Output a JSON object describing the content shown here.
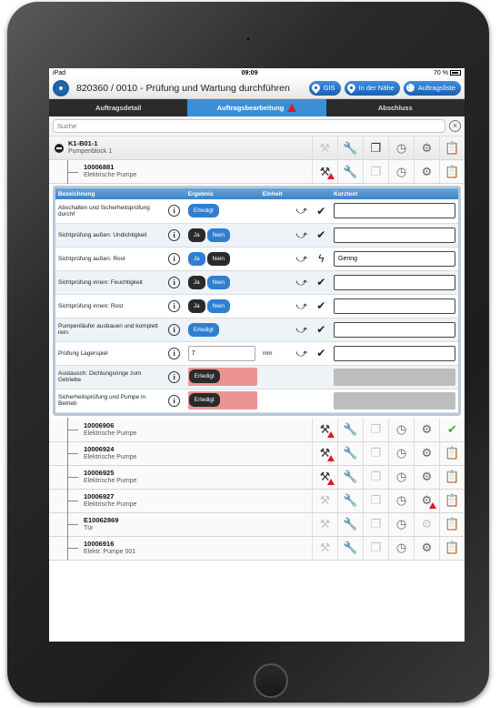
{
  "status": {
    "device": "iPad",
    "time": "09:09",
    "battery": "70 %"
  },
  "header": {
    "title": "820360 / 0010 - Prüfung und Wartung durchführen",
    "gis": "GIS",
    "nearby": "In der Nähe",
    "orders": "Auftragsliste"
  },
  "tabs": [
    "Auftragsdetail",
    "Auftragsbearbeitung",
    "Abschluss"
  ],
  "search": {
    "placeholder": "Suche"
  },
  "top_rows": [
    {
      "id": "K1-B01-1",
      "desc": "Pumpenblock 1"
    },
    {
      "id": "10006881",
      "desc": "Elektrische Pumpe"
    }
  ],
  "table": {
    "headers": [
      "Bezeichnung",
      "Ergebnis",
      "Einheit",
      "Kurztext"
    ],
    "rows": [
      {
        "name": "Abschalten und Sicherheitsprüfung durchf",
        "result": "Erledigt",
        "unit": "",
        "kurztext": ""
      },
      {
        "name": "Sichtprüfung außen: Undichtigkeit",
        "ja": "Ja",
        "nein": "Nein",
        "unit": "",
        "kurztext": ""
      },
      {
        "name": "Sichtprüfung außen: Rost",
        "ja": "Ja",
        "nein": "Nein",
        "unit": "",
        "kurztext": "Gering"
      },
      {
        "name": "Sichtprüfung innen: Feuchtigkeit",
        "ja": "Ja",
        "nein": "Nein",
        "unit": "",
        "kurztext": ""
      },
      {
        "name": "Sichtprüfung innen: Rost",
        "ja": "Ja",
        "nein": "Nein",
        "unit": "",
        "kurztext": ""
      },
      {
        "name": "Pumpenläufer ausbauen und komplett rein.",
        "result": "Erledigt",
        "unit": "",
        "kurztext": ""
      },
      {
        "name": "Prüfung Lagerspiel",
        "value": "7",
        "unit": "mm",
        "kurztext": ""
      },
      {
        "name": "Austausch: Dichtungsringe zum Getriebe",
        "result": "Erledigt",
        "unit": "",
        "kurztext": ""
      },
      {
        "name": "Sicherheitsprüfung und Pumpe in Betrieb",
        "result": "Erledigt",
        "unit": "",
        "kurztext": ""
      }
    ]
  },
  "bottom_rows": [
    {
      "id": "10006906",
      "desc": "Elektrische Pumpe"
    },
    {
      "id": "10006924",
      "desc": "Elektrische Pumpe"
    },
    {
      "id": "10006925",
      "desc": "Elektrische Pumpe"
    },
    {
      "id": "10006927",
      "desc": "Elektrische Pumpe"
    },
    {
      "id": "E10062869",
      "desc": "Tür"
    },
    {
      "id": "10006916",
      "desc": "Elektr. Pumpe 001"
    }
  ],
  "colors": {
    "accent": "#3a8fd6",
    "warning": "#d81e1e",
    "ok": "#4ca53c"
  }
}
